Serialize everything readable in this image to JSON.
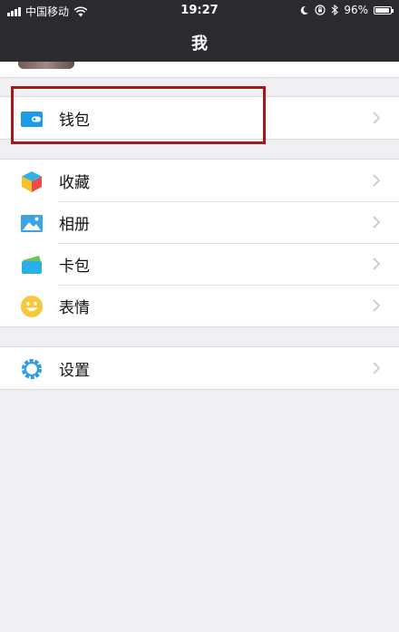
{
  "status_bar": {
    "carrier": "中国移动",
    "time": "19:27",
    "battery": "96%",
    "battery_level": 0.96
  },
  "nav": {
    "title": "我"
  },
  "groups": [
    {
      "items": [
        {
          "label": "钱包",
          "icon": "wallet-icon"
        }
      ]
    },
    {
      "items": [
        {
          "label": "收藏",
          "icon": "favorites-cube-icon"
        },
        {
          "label": "相册",
          "icon": "album-icon"
        },
        {
          "label": "卡包",
          "icon": "card-wallet-icon"
        },
        {
          "label": "表情",
          "icon": "smiley-icon"
        }
      ]
    },
    {
      "items": [
        {
          "label": "设置",
          "icon": "gear-icon"
        }
      ]
    }
  ],
  "colors": {
    "nav_bg": "#2b2b2f",
    "page_bg": "#efeff4",
    "wallet_blue": "#1c9be8",
    "highlight_red": "#a11b1b"
  }
}
